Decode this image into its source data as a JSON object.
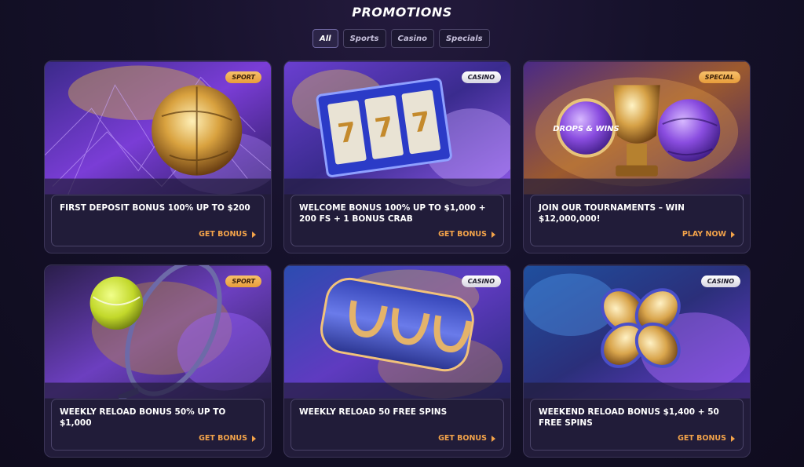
{
  "page": {
    "title": "PROMOTIONS"
  },
  "tabs": [
    {
      "label": "All",
      "active": true
    },
    {
      "label": "Sports",
      "active": false
    },
    {
      "label": "Casino",
      "active": false
    },
    {
      "label": "Specials",
      "active": false
    }
  ],
  "colors": {
    "accent": "#f3a34a",
    "background": "#15112a",
    "card": "#221c3a",
    "badge_sport": "#f0ae4e",
    "badge_casino": "#ecebf2"
  },
  "promos": [
    {
      "badge": "SPORT",
      "badge_type": "sport",
      "title": "FIRST DEPOSIT BONUS 100% UP TO $200",
      "cta": "GET BONUS",
      "art": "golden-soccer-ball-in-net"
    },
    {
      "badge": "CASINO",
      "badge_type": "casino",
      "title": "WELCOME BONUS 100% UP TO $1,000 + 200 FS + 1 BONUS CRAB",
      "cta": "GET BONUS",
      "art": "slot-reels-777"
    },
    {
      "badge": "SPECIAL",
      "badge_type": "special",
      "title": "JOIN OUR TOURNAMENTS – WIN $12,000,000!",
      "cta": "PLAY NOW",
      "art": "drops-and-wins-trophy-ball",
      "art_text": "DROPS & WINS"
    },
    {
      "badge": "SPORT",
      "badge_type": "sport",
      "title": "WEEKLY RELOAD BONUS 50% UP TO $1,000",
      "cta": "GET BONUS",
      "art": "tennis-ball-racket"
    },
    {
      "badge": "CASINO",
      "badge_type": "casino",
      "title": "WEEKLY RELOAD 50 FREE SPINS",
      "cta": "GET BONUS",
      "art": "horseshoe-slot-reel"
    },
    {
      "badge": "CASINO",
      "badge_type": "casino",
      "title": "WEEKEND RELOAD BONUS $1,400 + 50 FREE SPINS",
      "cta": "GET BONUS",
      "art": "golden-four-leaf-clover"
    }
  ]
}
